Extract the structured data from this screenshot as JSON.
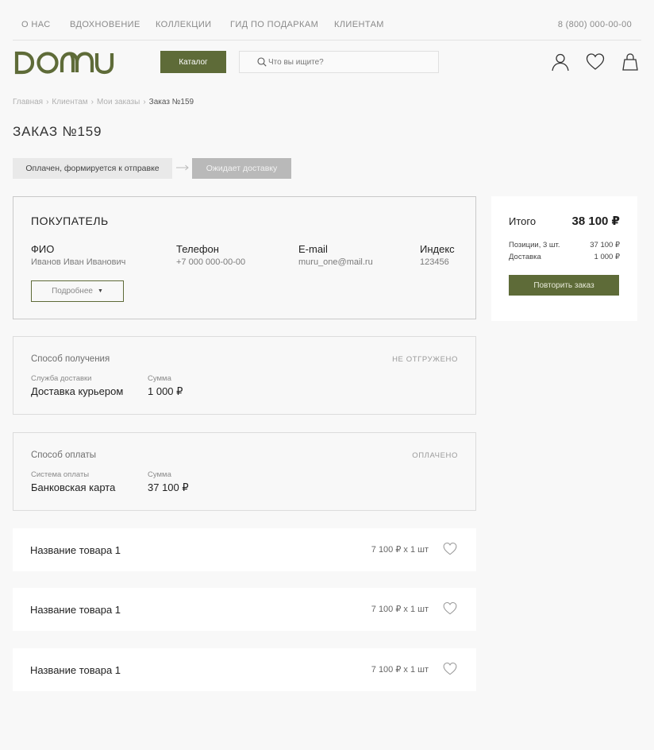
{
  "topnav": {
    "items": [
      "О НАС",
      "ВДОХНОВЕНИЕ",
      "КОЛЛЕКЦИИ",
      "ГИД ПО ПОДАРКАМ",
      "КЛИЕНТАМ"
    ],
    "phone": "8 (800) 000-00-00"
  },
  "header": {
    "logo_text": "DOMU",
    "catalog_label": "Каталог",
    "search_placeholder": "Что вы ищите?",
    "icons": [
      "user-icon",
      "heart-icon",
      "bag-icon"
    ]
  },
  "breadcrumb": {
    "items": [
      "Главная",
      "Клиентам",
      "Мои заказы"
    ],
    "current": "Заказ №159"
  },
  "page_title": "ЗАКАЗ №159",
  "status": {
    "current": "Оплачен, формируется к отправке",
    "next": "Ожидает доставку"
  },
  "buyer": {
    "title": "ПОКУПАТЕЛЬ",
    "fields": [
      {
        "label": "ФИО",
        "value": "Иванов Иван Иванович"
      },
      {
        "label": "Телефон",
        "value": "+7 000 000-00-00"
      },
      {
        "label": "E-mail",
        "value": "muru_one@mail.ru"
      },
      {
        "label": "Индекс",
        "value": "123456"
      }
    ],
    "more_label": "Подробнее"
  },
  "delivery": {
    "title": "Способ получения",
    "status": "НЕ ОТГРУЖЕНО",
    "service_label": "Служба доставки",
    "service_value": "Доставка курьером",
    "sum_label": "Сумма",
    "sum_value": "1 000 ₽"
  },
  "payment": {
    "title": "Способ оплаты",
    "status": "ОПЛАЧЕНО",
    "system_label": "Система оплаты",
    "system_value": "Банковская карта",
    "sum_label": "Сумма",
    "sum_value": "37 100 ₽"
  },
  "summary": {
    "total_label": "Итого",
    "total_value": "38 100 ₽",
    "positions_label": "Позиции, 3 шт.",
    "positions_value": "37 100 ₽",
    "delivery_label": "Доставка",
    "delivery_value": "1 000 ₽",
    "repeat_label": "Повторить заказ"
  },
  "products": [
    {
      "name": "Название товара 1",
      "price": "7 100 ₽ x 1 шт"
    },
    {
      "name": "Название товара 1",
      "price": "7 100 ₽ x 1 шт"
    },
    {
      "name": "Название товара 1",
      "price": "7 100 ₽ x 1 шт"
    }
  ],
  "colors": {
    "accent": "#5e6b38",
    "background": "#f8f8f8",
    "status_pending": "#b9b9b9"
  }
}
